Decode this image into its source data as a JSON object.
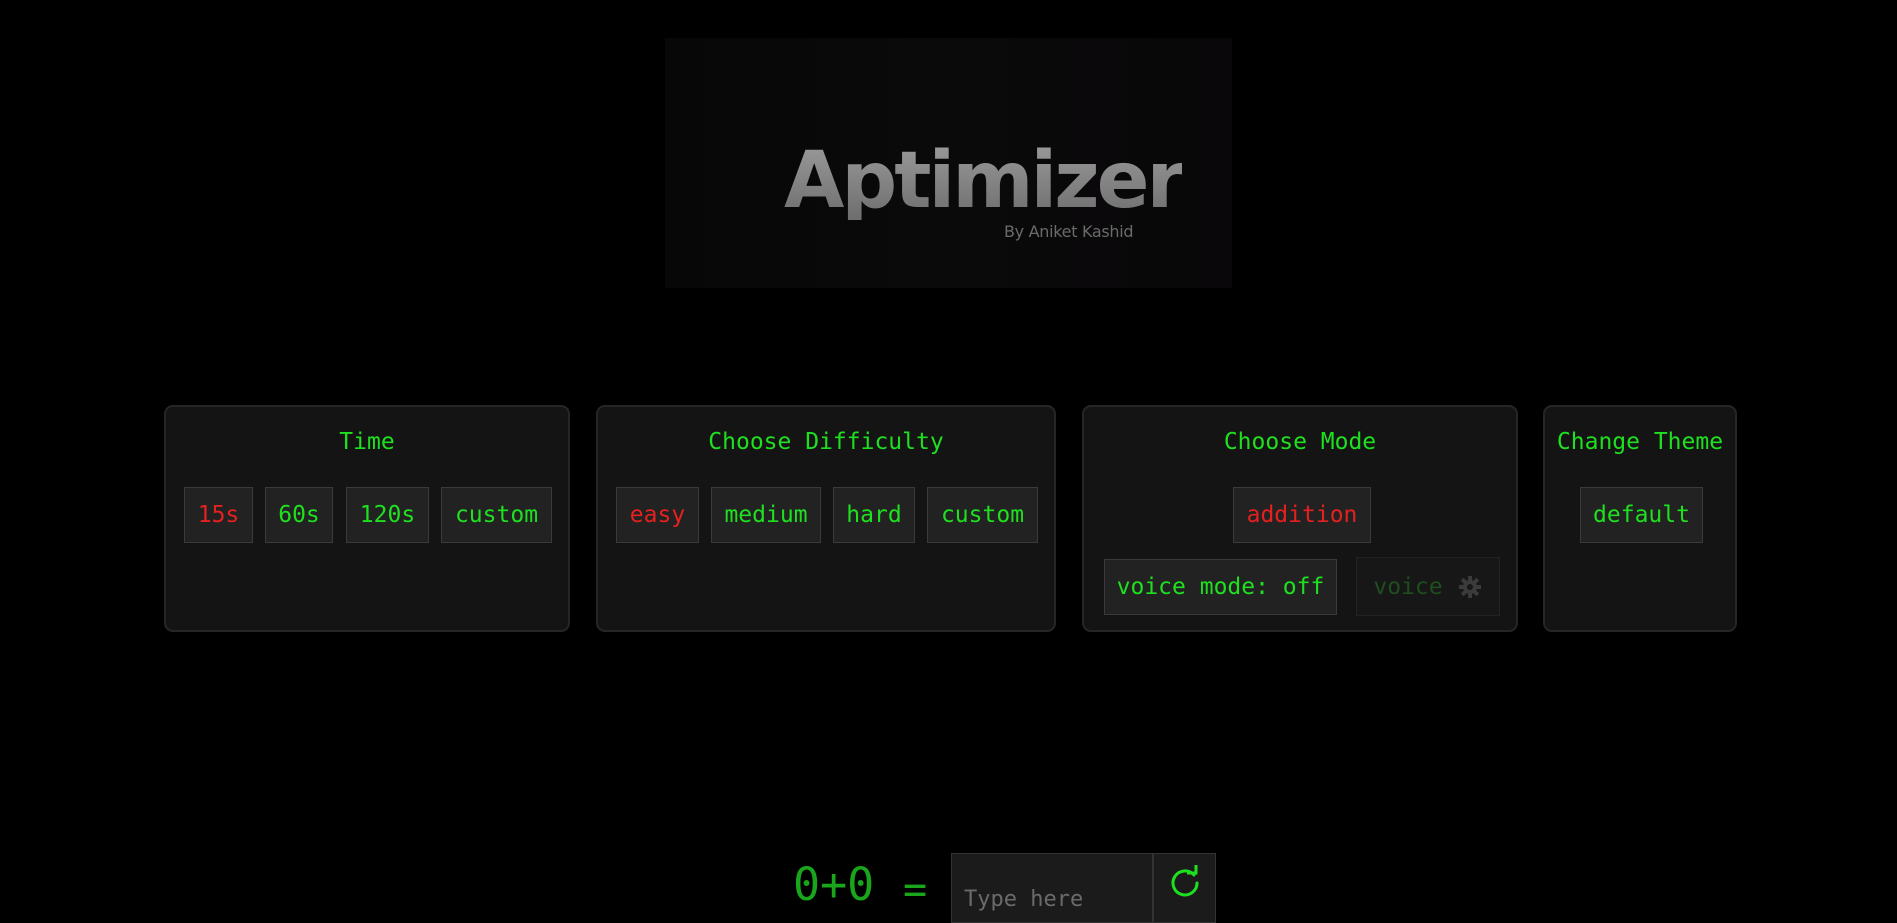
{
  "header": {
    "title": "Aptimizer",
    "byline": "By Aniket Kashid"
  },
  "time": {
    "title": "Time",
    "options": [
      "15s",
      "60s",
      "120s",
      "custom"
    ],
    "selected": "15s"
  },
  "difficulty": {
    "title": "Choose Difficulty",
    "options": [
      "easy",
      "medium",
      "hard",
      "custom"
    ],
    "selected": "easy"
  },
  "mode": {
    "title": "Choose Mode",
    "selected_mode": "addition",
    "voice_mode_label": "voice mode: off",
    "voice_settings_label": "voice"
  },
  "theme": {
    "title": "Change Theme",
    "selected": "default"
  },
  "question": {
    "expression": "0+0",
    "equals": "=",
    "answer_placeholder": "Type here"
  },
  "icons": {
    "voice_settings": "gear-icon",
    "reset": "refresh-icon"
  },
  "colors": {
    "accent": "#1fe01f",
    "active": "#e52020",
    "card_bg": "#141414",
    "page_bg": "#000000"
  }
}
